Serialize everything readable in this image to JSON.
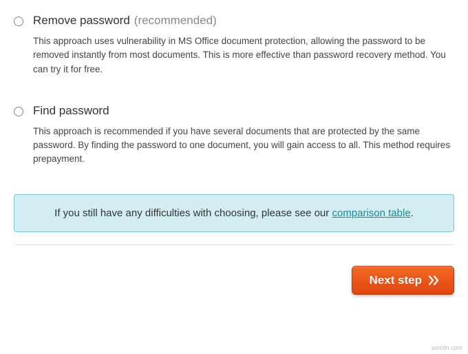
{
  "options": [
    {
      "title": "Remove password",
      "recommended": "(recommended)",
      "description": "This approach uses vulnerability in MS Office document protection, allowing the password to be removed instantly from most documents. This is more effective than password recovery method. You can try it for free."
    },
    {
      "title": "Find password",
      "recommended": "",
      "description": "This approach is recommended if you have several documents that are protected by the same password. By finding the password to one document, you will gain access to all. This method requires prepayment."
    }
  ],
  "info": {
    "prefix": "If you still have any difficulties with choosing, please see our ",
    "link": "comparison table",
    "suffix": "."
  },
  "button": {
    "label": "Next step"
  },
  "watermark": "wsxdn.com"
}
